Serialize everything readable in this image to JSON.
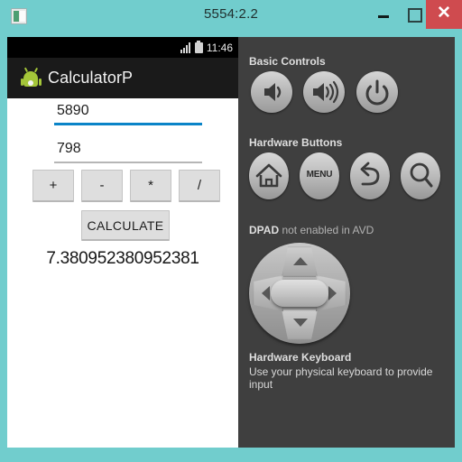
{
  "window": {
    "title": "5554:2.2",
    "icon": "emulator-app-icon",
    "minimize_label": "–",
    "maximize_label": "□",
    "close_label": "✕",
    "frame_color": "#71cdcd",
    "close_color": "#cf4b4f"
  },
  "device": {
    "status_bar": {
      "time": "11:46",
      "signal_icon": "signal-bars-icon",
      "battery_icon": "battery-icon"
    },
    "action_bar": {
      "icon": "android-robot-icon",
      "app_title": "CalculatorP",
      "background": "#1a1a1a"
    },
    "calculator": {
      "operand_a": {
        "value": "5890",
        "placeholder": "",
        "underline_color": "#0a84c8",
        "focused": true
      },
      "operand_b": {
        "value": "798",
        "placeholder": "",
        "underline_color": "#b6b6b6",
        "focused": false
      },
      "operators": [
        {
          "name": "add",
          "label": "+"
        },
        {
          "name": "subtract",
          "label": "-"
        },
        {
          "name": "multiply",
          "label": "*"
        },
        {
          "name": "divide",
          "label": "/"
        }
      ],
      "calculate_label": "CALCULATE",
      "result": "7.380952380952381"
    }
  },
  "control_panel": {
    "background": "#3f3f3f",
    "basic_controls": {
      "heading": "Basic Controls",
      "buttons": [
        {
          "name": "volume-down",
          "icon": "volume-down-icon"
        },
        {
          "name": "volume-up",
          "icon": "volume-up-icon"
        },
        {
          "name": "power",
          "icon": "power-icon"
        }
      ]
    },
    "hardware_buttons": {
      "heading": "Hardware Buttons",
      "buttons": [
        {
          "name": "home",
          "icon": "home-icon",
          "label": ""
        },
        {
          "name": "menu",
          "icon": "menu-text-icon",
          "label": "MENU"
        },
        {
          "name": "back",
          "icon": "back-arrow-icon",
          "label": ""
        },
        {
          "name": "search",
          "icon": "search-magnifier-icon",
          "label": ""
        }
      ]
    },
    "dpad": {
      "heading": "DPAD",
      "note": " not enabled in AVD",
      "directions": [
        "up",
        "down",
        "left",
        "right"
      ],
      "center_label": ""
    },
    "hardware_keyboard": {
      "heading": "Hardware Keyboard",
      "note": "Use your physical keyboard to provide input"
    }
  }
}
